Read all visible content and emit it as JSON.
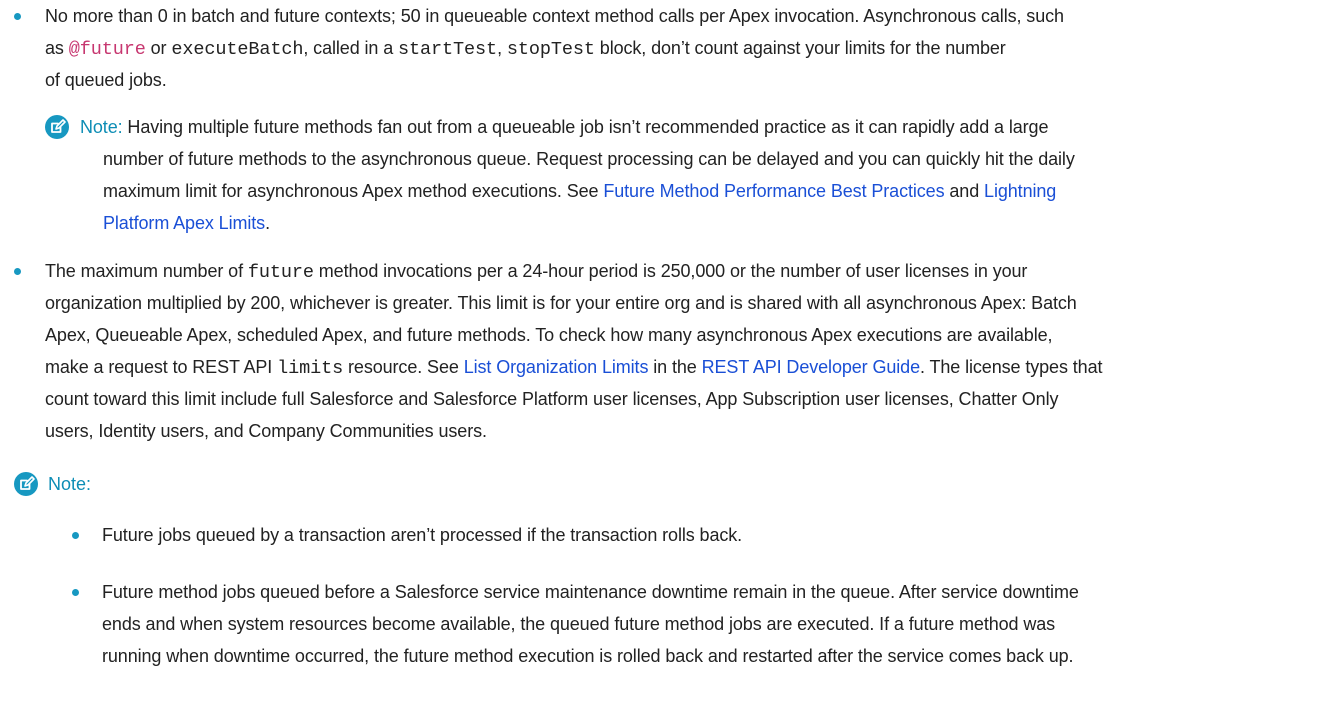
{
  "bullet1": {
    "t1": "No more than 0 in batch and future contexts; 50 in queueable context method calls per Apex invocation. Asynchronous calls, such",
    "t2a": "as ",
    "code_future": "@future",
    "t2b": " or ",
    "code_executeBatch": "executeBatch",
    "t2c": ", called in a ",
    "code_startTest": "startTest",
    "t2d": ", ",
    "code_stopTest": "stopTest",
    "t2e": " block, don’t count against your limits for the number",
    "t3": "of queued jobs."
  },
  "note1": {
    "label": "Note:",
    "l1": " Having multiple future methods fan out from a queueable job isn’t recommended practice as it can rapidly add a large",
    "l2": "number of future methods to the asynchronous queue. Request processing can be delayed and you can quickly hit the daily",
    "l3a": "maximum limit for asynchronous Apex method executions. See ",
    "link1": "Future Method Performance Best Practices",
    "l3b": " and ",
    "link2a": "Lightning",
    "link2b": "Platform Apex Limits",
    "l4": "."
  },
  "bullet2": {
    "l1a": "The maximum number of ",
    "code_future": "future",
    "l1b": " method invocations per a 24-hour period is 250,000 or the number of user licenses in your",
    "l2": "organization multiplied by 200, whichever is greater. This limit is for your entire org and is shared with all asynchronous Apex: Batch",
    "l3": "Apex, Queueable Apex, scheduled Apex, and future methods. To check how many asynchronous Apex executions are available,",
    "l4a": "make a request to REST API ",
    "code_limits": "limits",
    "l4b": " resource. See ",
    "link1": "List Organization Limits",
    "l4c": " in the ",
    "link2": "REST API Developer Guide",
    "l4d": ". The license types that",
    "l5": "count toward this limit include full Salesforce and Salesforce Platform user licenses, App Subscription user licenses, Chatter Only",
    "l6": "users, Identity users, and Company Communities users."
  },
  "note2": {
    "label": "Note:",
    "items": [
      {
        "l1": "Future jobs queued by a transaction aren’t processed if the transaction rolls back."
      },
      {
        "l1": "Future method jobs queued before a Salesforce service maintenance downtime remain in the queue. After service downtime",
        "l2": "ends and when system resources become available, the queued future method jobs are executed. If a future method was",
        "l3": "running when downtime occurred, the future method execution is rolled back and restarted after the service comes back up."
      }
    ]
  },
  "colors": {
    "bullet": "#1798c1",
    "link": "#1a4fd6",
    "note_label": "#0d8db5",
    "code_accent": "#c73770"
  },
  "icons": {
    "note": "note-edit-icon"
  }
}
